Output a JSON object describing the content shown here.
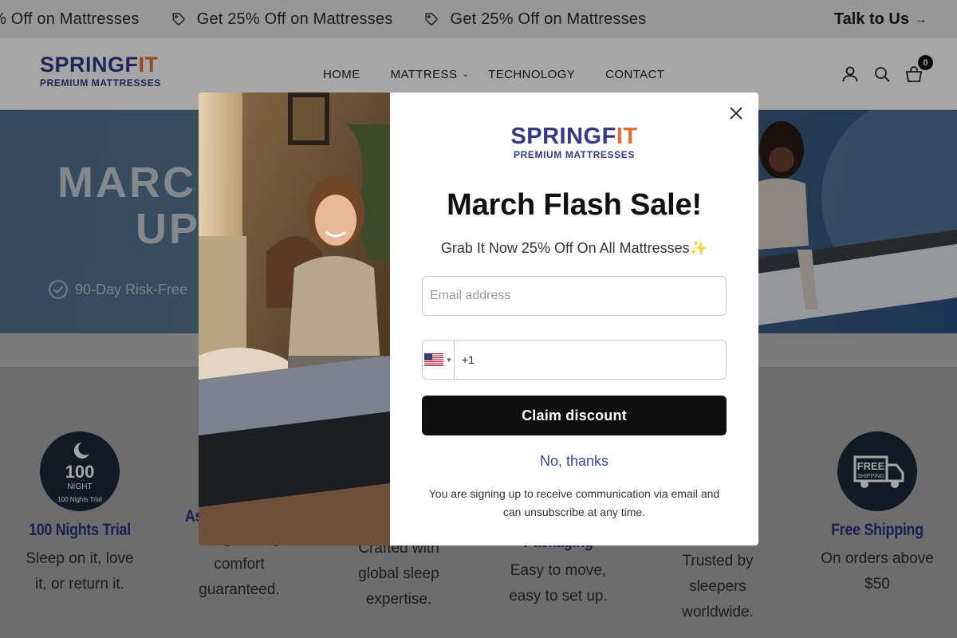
{
  "announcement": {
    "messages": [
      "% Off on Mattresses",
      "Get 25% Off on Mattresses",
      "Get 25% Off on Mattresses"
    ],
    "talk_label": "Talk to Us",
    "talk_arrow": "→"
  },
  "brand": {
    "name_part1": "SPRINGF",
    "name_part2": "IT",
    "tagline": "PREMIUM MATTRESSES"
  },
  "nav": {
    "items": [
      {
        "label": "HOME"
      },
      {
        "label": "MATTRESS",
        "has_dropdown": true
      },
      {
        "label": "TECHNOLOGY"
      },
      {
        "label": "CONTACT"
      }
    ]
  },
  "header_icons": {
    "account": "user-icon",
    "search": "search-icon",
    "cart": "cart-icon",
    "cart_count": "0"
  },
  "hero": {
    "title_line1": "MARC",
    "title_line2": "UP",
    "trial_text": "90-Day Risk-Free"
  },
  "features": [
    {
      "icon": "moon-100-night-badge-icon",
      "badge_big": "100",
      "badge_small": "NIGHT",
      "badge_arc": "100 Nights Trial",
      "title": "100 Nights Trial",
      "desc_lines": [
        "Sleep on it, love",
        "it, or return it."
      ]
    },
    {
      "title": "As",
      "desc_lines": [
        "Long-lasting",
        "comfort",
        "guaranteed."
      ]
    },
    {
      "desc_lines": [
        "Crafted with",
        "global sleep",
        "expertise."
      ]
    },
    {
      "title": "Packaging",
      "desc_lines": [
        "Easy to move,",
        "easy to set up."
      ]
    },
    {
      "desc_lines": [
        "Trusted by",
        "sleepers",
        "worldwide."
      ]
    },
    {
      "icon": "free-shipping-truck-icon",
      "badge_big": "FREE",
      "badge_small": "SHIPPING",
      "title": "Free Shipping",
      "desc_lines": [
        "On orders above",
        "$50"
      ]
    }
  ],
  "modal": {
    "title": "March Flash Sale!",
    "subtitle": "Grab It Now 25% Off On All Mattresses",
    "sparkle": "✨",
    "email_placeholder": "Email address",
    "phone_code": "+1",
    "country": "US",
    "claim_label": "Claim discount",
    "no_thanks_label": "No, thanks",
    "disclaimer": "You are signing up to receive communication via email and can unsubscribe at any time."
  },
  "colors": {
    "brand_blue": "#2f3b87",
    "brand_orange": "#e86d2b",
    "feature_title": "#25337d",
    "button_black": "#0f0f0f",
    "link_blue": "#2f4b9c"
  }
}
